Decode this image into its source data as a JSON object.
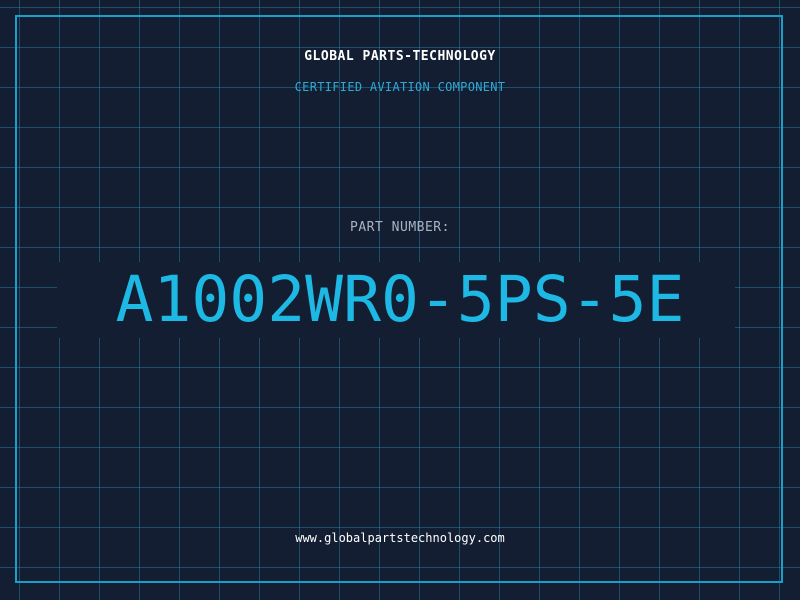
{
  "header": {
    "company_name": "GLOBAL PARTS-TECHNOLOGY",
    "tagline": "CERTIFIED AVIATION COMPONENT"
  },
  "part": {
    "label": "PART NUMBER:",
    "number": "A1002WR0-5PS-5E"
  },
  "footer": {
    "website": "www.globalpartstechnology.com"
  },
  "colors": {
    "background": "#141e33",
    "grid": "#267696",
    "frame": "#1a9fc9",
    "accent": "#1db8e3"
  }
}
